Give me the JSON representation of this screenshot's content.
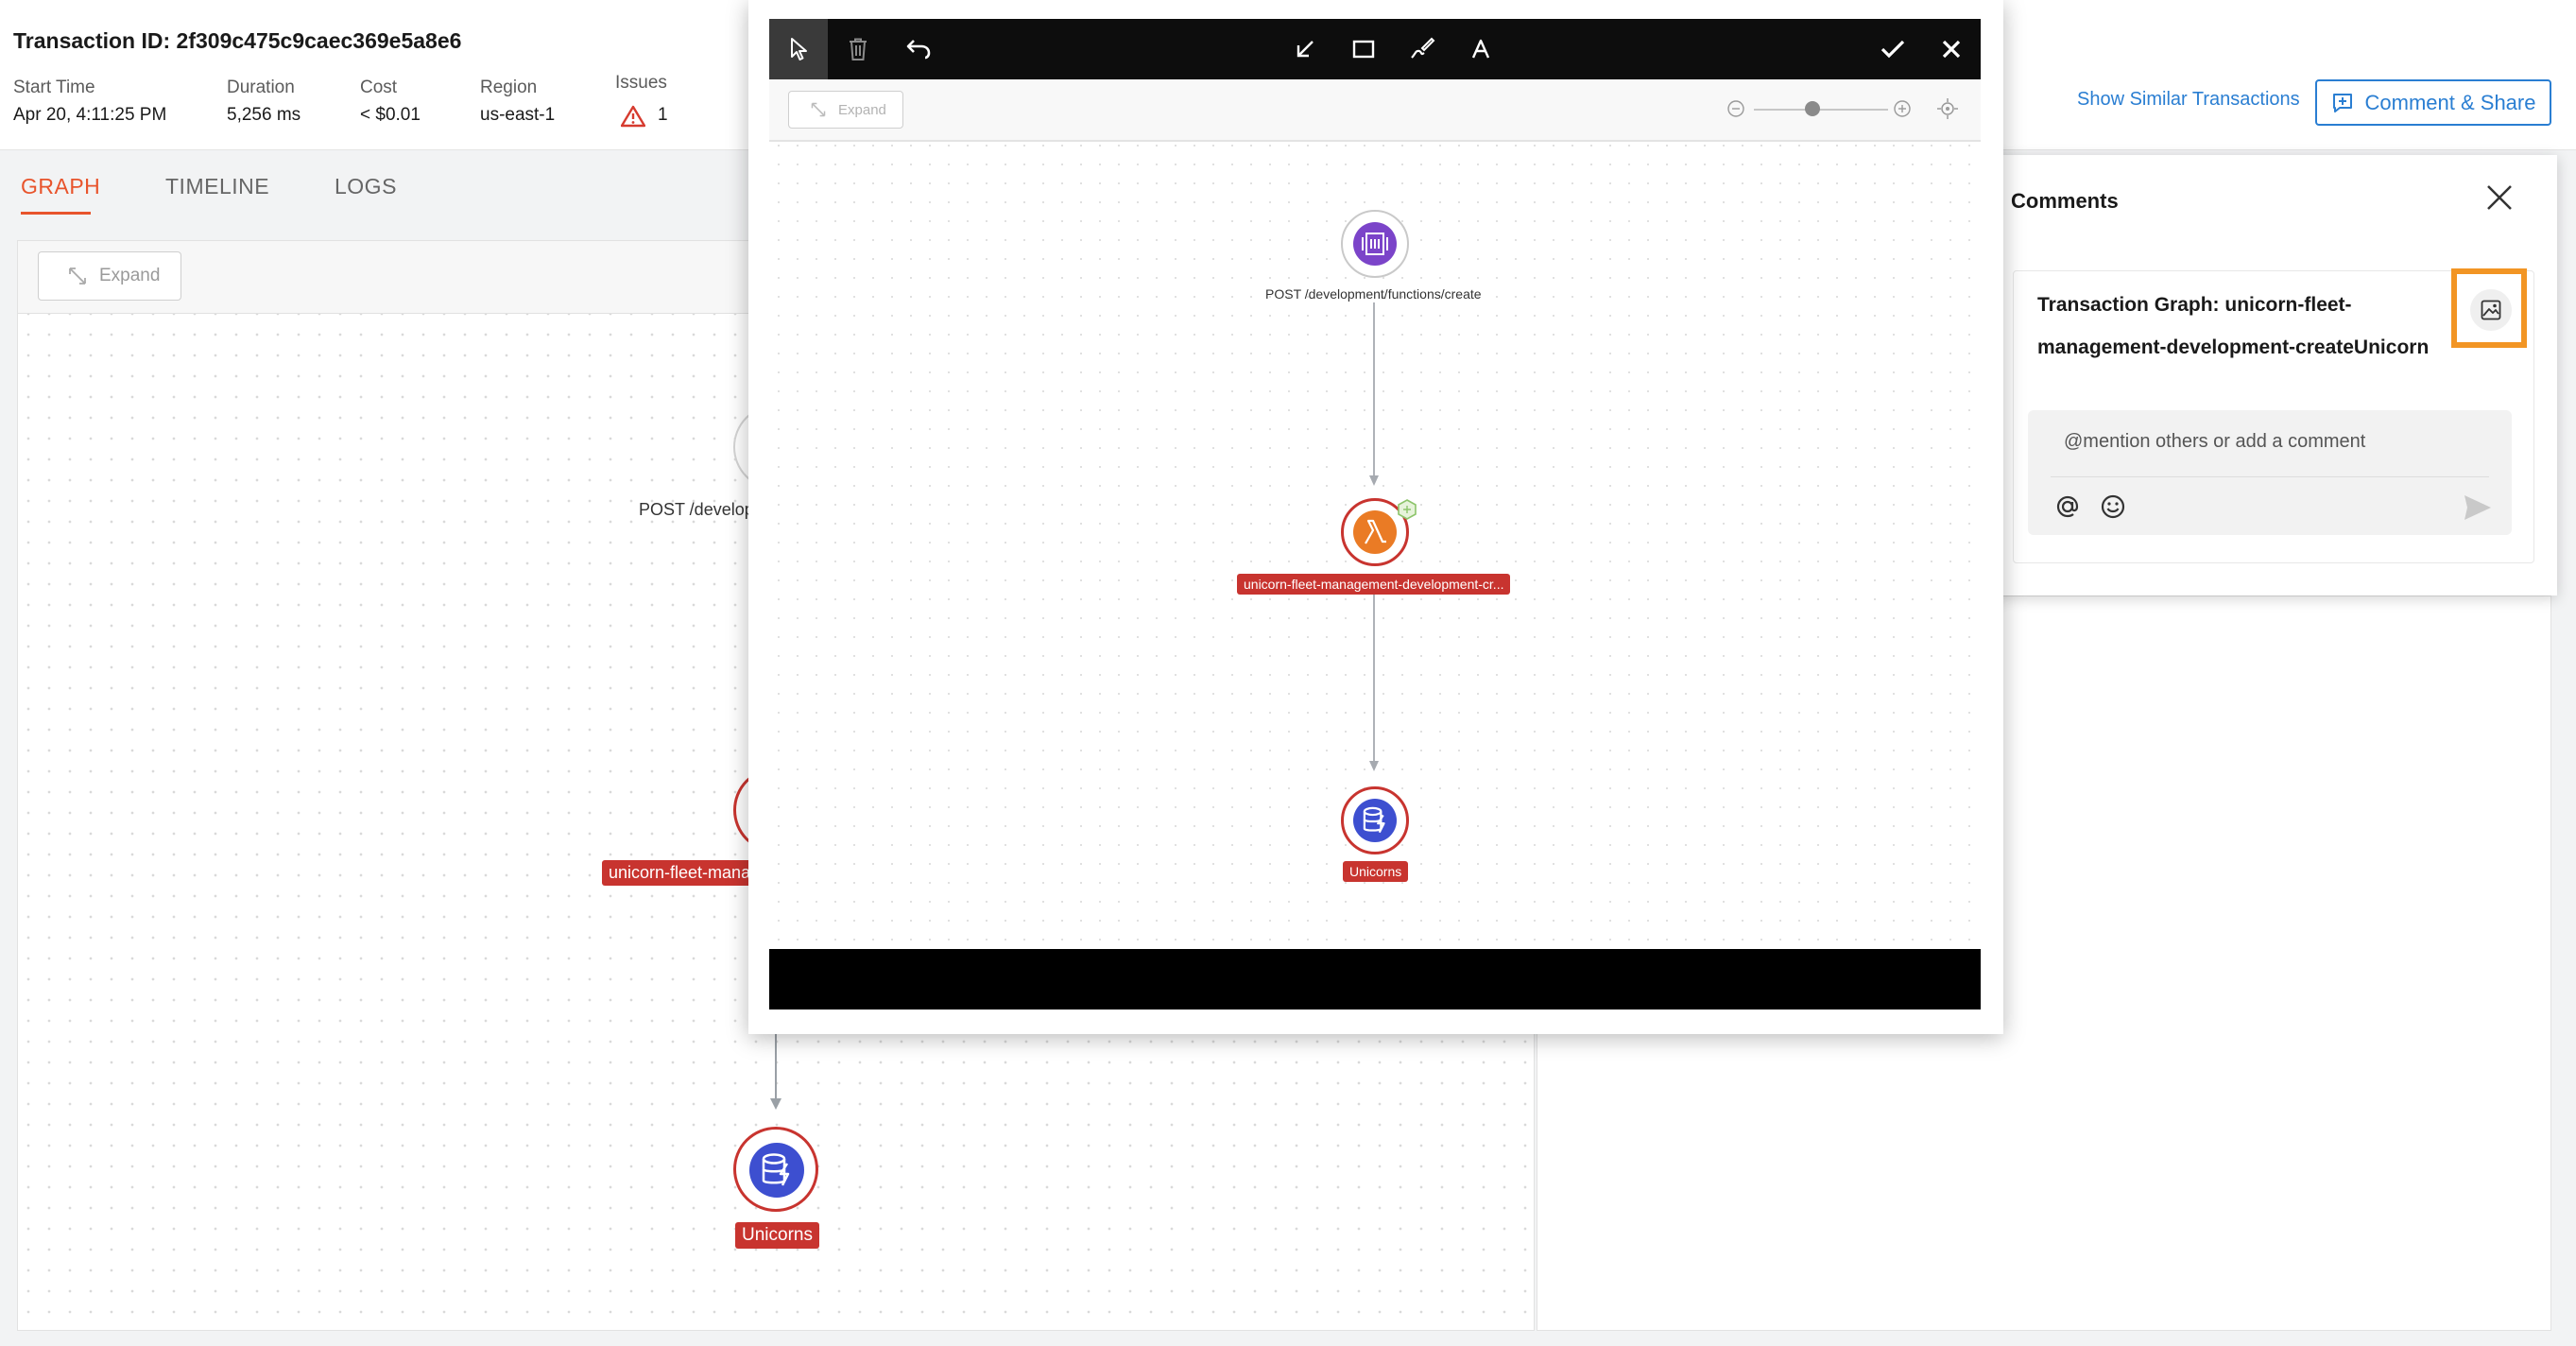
{
  "header": {
    "transaction_id": "Transaction ID: 2f309c475c9caec369e5a8e6",
    "meta": [
      {
        "label": "Start Time",
        "value": "Apr 20, 4:11:25 PM"
      },
      {
        "label": "Duration",
        "value": "5,256 ms"
      },
      {
        "label": "Cost",
        "value": "< $0.01"
      },
      {
        "label": "Region",
        "value": "us-east-1"
      },
      {
        "label": "Issues",
        "value": "1"
      }
    ],
    "show_similar": "Show Similar Transactions",
    "comment_share": "Comment & Share"
  },
  "tabs": [
    "GRAPH",
    "TIMELINE",
    "LOGS"
  ],
  "graph": {
    "expand": "Expand",
    "node_api": "POST /develop",
    "node_lambda": "unicorn-fleet-mana",
    "node_db": "Unicorns"
  },
  "comments": {
    "title": "Comments",
    "card_title": "Transaction Graph: unicorn-fleet-management-development-createUnicorn",
    "placeholder": "@mention others or add a comment"
  },
  "modal": {
    "expand": "Expand",
    "node_api": "POST /development/functions/create",
    "node_lambda": "unicorn-fleet-management-development-cr...",
    "node_db": "Unicorns"
  },
  "colors": {
    "accent_orange": "#e8542c",
    "link_blue": "#2a7ed2",
    "error_red": "#c8342f",
    "highlight": "#f29524"
  },
  "icons": [
    "warning-icon",
    "comment-share-icon",
    "select-tool-icon",
    "trash-icon",
    "undo-icon",
    "arrow-tool-icon",
    "rectangle-tool-icon",
    "pen-tool-icon",
    "text-tool-icon",
    "check-icon",
    "close-icon",
    "zoom-out-icon",
    "zoom-in-icon",
    "recenter-icon",
    "api-gateway-icon",
    "lambda-icon",
    "dynamodb-icon",
    "image-icon",
    "mention-icon",
    "emoji-icon",
    "send-icon",
    "expand-icon"
  ]
}
